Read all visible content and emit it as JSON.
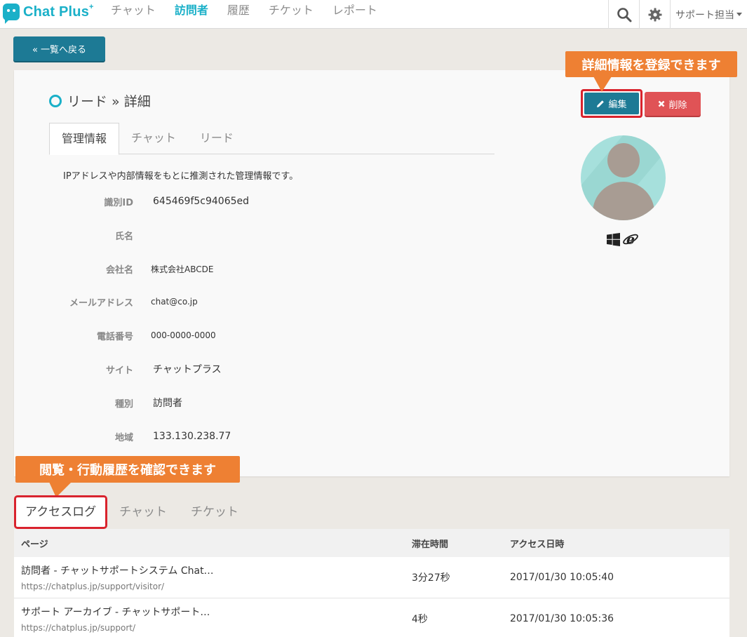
{
  "brand": {
    "name": "Chat Plus",
    "mark": "+"
  },
  "nav": {
    "items": [
      "チャット",
      "訪問者",
      "履歴",
      "チケット",
      "レポート"
    ],
    "active_index": 1
  },
  "header": {
    "user_menu": "サポート担当"
  },
  "back_button": {
    "label": "« 一覧へ戻る"
  },
  "detail": {
    "title": "リード » 詳細",
    "tabs": [
      "管理情報",
      "チャット",
      "リード"
    ],
    "description": "IPアドレスや内部情報をもとに推測された管理情報です。",
    "fields": [
      {
        "label": "識別ID",
        "value": "645469f5c94065ed"
      },
      {
        "label": "氏名",
        "value": ""
      },
      {
        "label": "会社名",
        "value": "株式会社ABCDE"
      },
      {
        "label": "メールアドレス",
        "value": "chat@co.jp"
      },
      {
        "label": "電話番号",
        "value": "000-0000-0000"
      },
      {
        "label": "サイト",
        "value": "チャットプラス"
      },
      {
        "label": "種別",
        "value": "訪問者"
      },
      {
        "label": "地域",
        "value": "133.130.238.77"
      }
    ],
    "edit_label": "編集",
    "delete_label": "削除"
  },
  "callouts": {
    "edit": "詳細情報を登録できます",
    "log": "閲覧・行動履歴を確認できます"
  },
  "log_tabs": [
    "アクセスログ",
    "チャット",
    "チケット"
  ],
  "access_log": {
    "headers": [
      "ページ",
      "滞在時間",
      "アクセス日時"
    ],
    "rows": [
      {
        "title": "訪問者 - チャットサポートシステム Chat…",
        "url": "https://chatplus.jp/support/visitor/",
        "duration": "3分27秒",
        "datetime": "2017/01/30 10:05:40"
      },
      {
        "title": "サポート アーカイブ - チャットサポート…",
        "url": "https://chatplus.jp/support/",
        "duration": "4秒",
        "datetime": "2017/01/30 10:05:36"
      }
    ]
  },
  "colors": {
    "accent": "#1ab0c8",
    "button": "#1d7a95",
    "danger": "#e05356",
    "callout": "#ee8033",
    "highlight": "#d9232d"
  }
}
